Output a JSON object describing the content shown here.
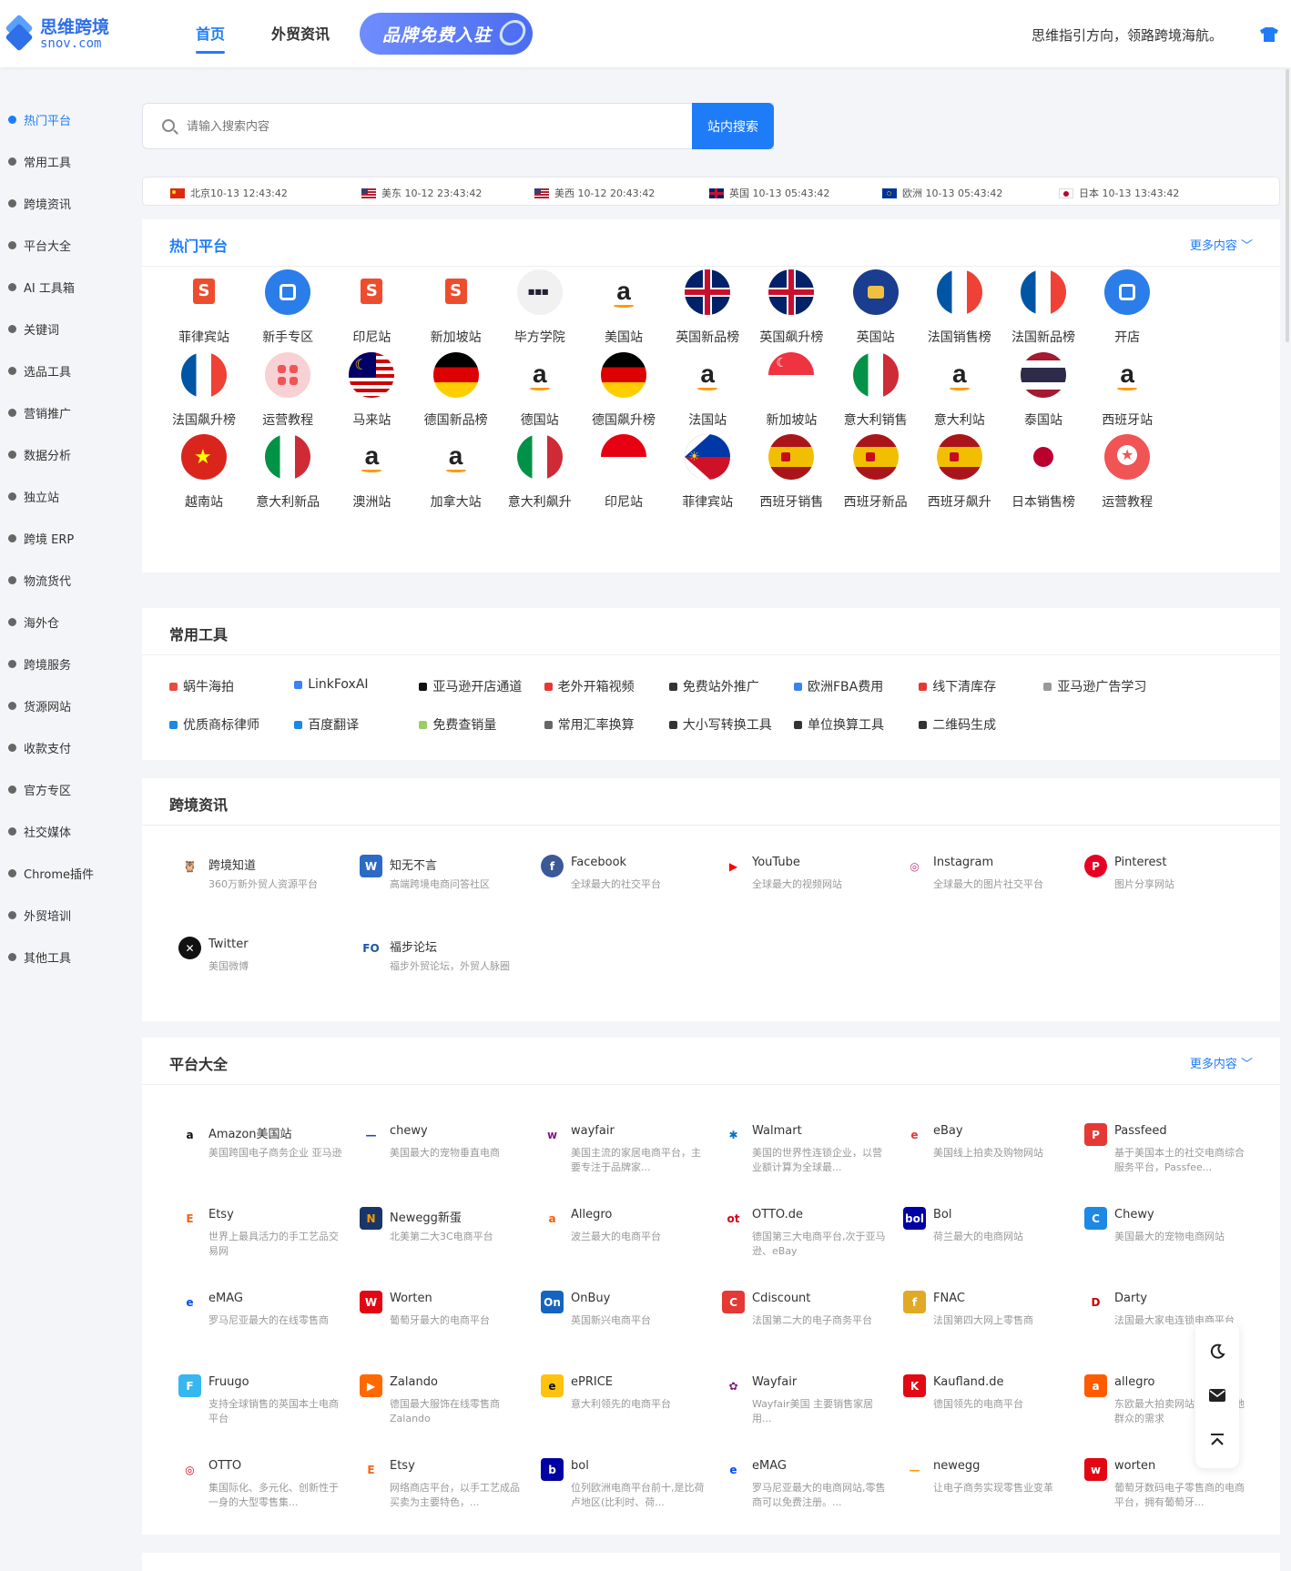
{
  "header": {
    "logo_cn": "思维跨境",
    "logo_en": "snov.com",
    "nav_home": "首页",
    "nav_news": "外贸资讯",
    "promo": "品牌免费入驻",
    "slogan": "思维指引方向，领路跨境海航。"
  },
  "sidebar": [
    "热门平台",
    "常用工具",
    "跨境资讯",
    "平台大全",
    "AI 工具箱",
    "关键词",
    "选品工具",
    "营销推广",
    "数据分析",
    "独立站",
    "跨境 ERP",
    "物流货代",
    "海外仓",
    "跨境服务",
    "货源网站",
    "收款支付",
    "官方专区",
    "社交媒体",
    "Chrome插件",
    "外贸培训",
    "其他工具"
  ],
  "search": {
    "placeholder": "请输入搜索内容",
    "button": "站内搜索"
  },
  "clocks": [
    {
      "label": "北京10-13 12:43:42"
    },
    {
      "label": "美东 10-12 23:43:42"
    },
    {
      "label": "美西 10-12 20:43:42"
    },
    {
      "label": "英国 10-13 05:43:42"
    },
    {
      "label": "欧洲 10-13 05:43:42"
    },
    {
      "label": "日本 10-13 13:43:42"
    }
  ],
  "hot": {
    "title": "热门平台",
    "more": "更多内容",
    "items": [
      "菲律宾站",
      "新手专区",
      "印尼站",
      "新加坡站",
      "毕方学院",
      "美国站",
      "英国新品榜",
      "英国飙升榜",
      "英国站",
      "法国销售榜",
      "法国新品榜",
      "开店",
      "法国飙升榜",
      "运营教程",
      "马来站",
      "德国新品榜",
      "德国站",
      "德国飙升榜",
      "法国站",
      "新加坡站",
      "意大利销售",
      "意大利站",
      "泰国站",
      "西班牙站",
      "越南站",
      "意大利新品",
      "澳洲站",
      "加拿大站",
      "意大利飙升",
      "印尼站",
      "菲律宾站",
      "西班牙销售",
      "西班牙新品",
      "西班牙飙升",
      "日本销售榜",
      "运营教程"
    ]
  },
  "tools": {
    "title": "常用工具",
    "items": [
      "蜗牛海拍",
      "LinkFoxAI",
      "亚马逊开店通道",
      "老外开箱视频",
      "免费站外推广",
      "欧洲FBA费用",
      "线下清库存",
      "亚马逊广告学习",
      "优质商标律师",
      "百度翻译",
      "免费查销量",
      "常用汇率换算",
      "大小写转换工具",
      "单位换算工具",
      "二维码生成"
    ]
  },
  "news": {
    "title": "跨境资讯",
    "items": [
      {
        "name": "跨境知道",
        "desc": "360万新外贸人资源平台"
      },
      {
        "name": "知无不言",
        "desc": "高端跨境电商问答社区"
      },
      {
        "name": "Facebook",
        "desc": "全球最大的社交平台"
      },
      {
        "name": "YouTube",
        "desc": "全球最大的视频网站"
      },
      {
        "name": "Instagram",
        "desc": "全球最大的图片社交平台"
      },
      {
        "name": "Pinterest",
        "desc": "图片分享网站"
      },
      {
        "name": "Twitter",
        "desc": "美国微博"
      },
      {
        "name": "福步论坛",
        "desc": "福步外贸论坛，外贸人脉圈"
      }
    ]
  },
  "platforms": {
    "title": "平台大全",
    "more": "更多内容",
    "items": [
      {
        "name": "Amazon美国站",
        "desc": "美国跨国电子商务企业 亚马逊"
      },
      {
        "name": "chewy",
        "desc": "美国最大的宠物垂直电商"
      },
      {
        "name": "wayfair",
        "desc": "美国主流的家居电商平台，主要专注于品牌家..."
      },
      {
        "name": "Walmart",
        "desc": "美国的世界性连锁企业，以营业额计算为全球最..."
      },
      {
        "name": "eBay",
        "desc": "美国线上拍卖及购物网站"
      },
      {
        "name": "Passfeed",
        "desc": "基于美国本土的社交电商综合服务平台，Passfee..."
      },
      {
        "name": "Etsy",
        "desc": "世界上最具活力的手工艺品交易网"
      },
      {
        "name": "Newegg新蛋",
        "desc": "北美第二大3C电商平台"
      },
      {
        "name": "Allegro",
        "desc": "波兰最大的电商平台"
      },
      {
        "name": "OTTO.de",
        "desc": "德国第三大电商平台,次于亚马逊、eBay"
      },
      {
        "name": "Bol",
        "desc": "荷兰最大的电商网站"
      },
      {
        "name": "Chewy",
        "desc": "美国最大的宠物电商网站"
      },
      {
        "name": "eMAG",
        "desc": "罗马尼亚最大的在线零售商"
      },
      {
        "name": "Worten",
        "desc": "葡萄牙最大的电商平台"
      },
      {
        "name": "OnBuy",
        "desc": "英国新兴电商平台"
      },
      {
        "name": "Cdiscount",
        "desc": "法国第二大的电子商务平台"
      },
      {
        "name": "FNAC",
        "desc": "法国第四大网上零售商"
      },
      {
        "name": "Darty",
        "desc": "法国最大家电连锁电商平台"
      },
      {
        "name": "Fruugo",
        "desc": "支持全球销售的英国本土电商平台"
      },
      {
        "name": "Zalando",
        "desc": "德国最大服饰在线零售商 Zalando"
      },
      {
        "name": "ePRICE",
        "desc": "意大利领先的电商平台"
      },
      {
        "name": "Wayfair",
        "desc": "Wayfair美国 主要销售家居用..."
      },
      {
        "name": "Kaufland.de",
        "desc": "德国领先的电商平台"
      },
      {
        "name": "allegro",
        "desc": "东欧最大拍卖网站，适应当地群众的需求"
      },
      {
        "name": "OTTO",
        "desc": "集国际化、多元化、创新性于一身的大型零售集..."
      },
      {
        "name": "Etsy",
        "desc": "网络商店平台，以手工艺成品买卖为主要特色，..."
      },
      {
        "name": "bol",
        "desc": "位列欧洲电商平台前十,是比荷卢地区(比利时、荷..."
      },
      {
        "name": "eMAG",
        "desc": "罗马尼亚最大的电商网站,零售商可以免费注册。..."
      },
      {
        "name": "newegg",
        "desc": "让电子商务实现零售业变革"
      },
      {
        "name": "worten",
        "desc": "葡萄牙数码电子零售商的电商平台，拥有葡萄牙..."
      }
    ]
  },
  "colors": {
    "accent": "#1f7cf8",
    "bg": "#f4f5f8"
  }
}
